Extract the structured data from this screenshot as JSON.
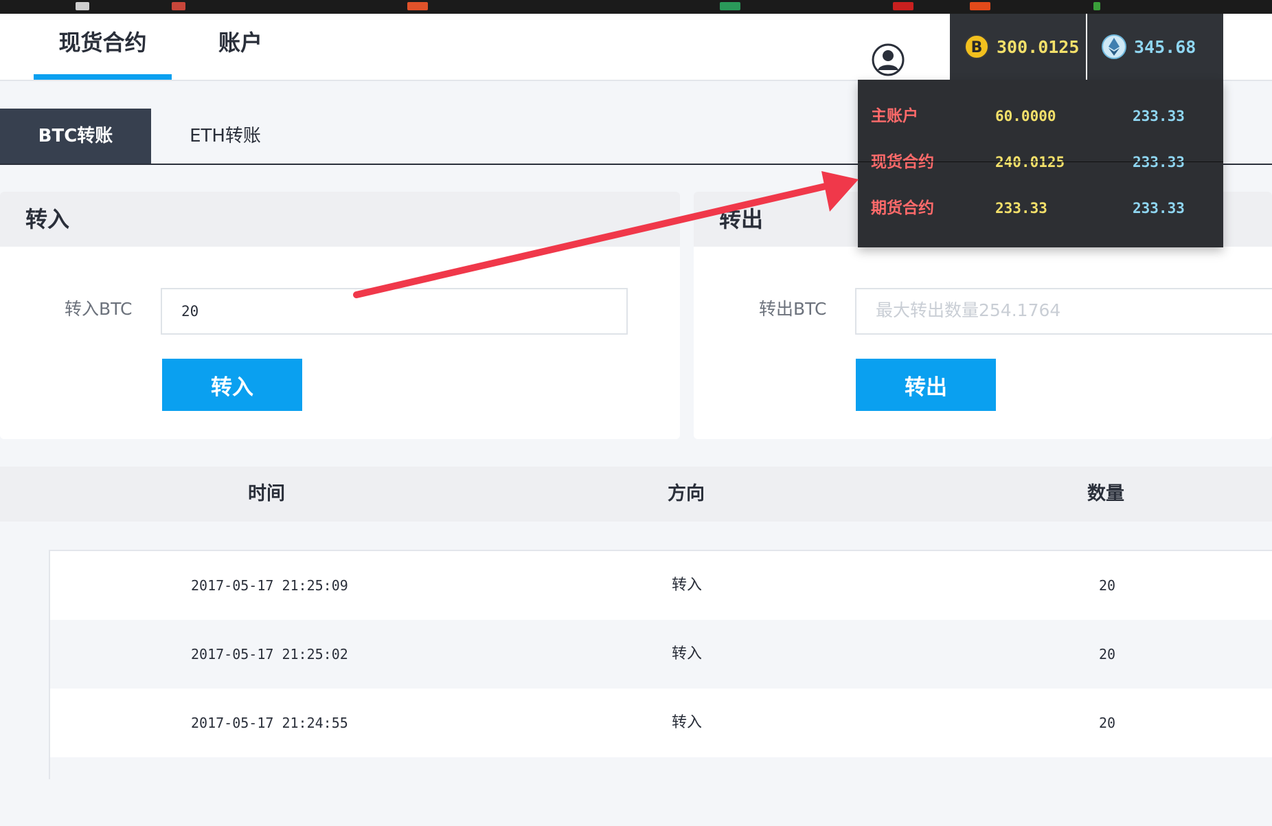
{
  "nav": {
    "tabs": [
      {
        "label": "现货合约"
      },
      {
        "label": "账户"
      }
    ],
    "active_tab": 0
  },
  "balances": {
    "btc": {
      "value": "300.0125",
      "icon": "bitcoin-icon",
      "color": "#f3e06a"
    },
    "eth": {
      "value": "345.68",
      "icon": "ethereum-icon",
      "color": "#8fd6f2"
    }
  },
  "balance_dropdown": {
    "rows": [
      {
        "name": "主账户",
        "btc": "60.0000",
        "eth": "233.33"
      },
      {
        "name": "现货合约",
        "btc": "240.0125",
        "eth": "233.33"
      },
      {
        "name": "期货合约",
        "btc": "233.33",
        "eth": "233.33"
      }
    ]
  },
  "subtabs": [
    {
      "label": "BTC转账"
    },
    {
      "label": "ETH转账"
    }
  ],
  "transfer_in": {
    "title": "转入",
    "label": "转入BTC",
    "value": "20",
    "button": "转入"
  },
  "transfer_out": {
    "title": "转出",
    "label": "转出BTC",
    "placeholder": "最大转出数量254.1764",
    "button": "转出"
  },
  "history": {
    "columns": [
      "时间",
      "方向",
      "数量"
    ],
    "rows": [
      {
        "time": "2017-05-17 21:25:09",
        "direction": "转入",
        "amount": "20"
      },
      {
        "time": "2017-05-17 21:25:02",
        "direction": "转入",
        "amount": "20"
      },
      {
        "time": "2017-05-17 21:24:55",
        "direction": "转入",
        "amount": "20"
      }
    ]
  },
  "colors": {
    "accent": "#0aa0f0",
    "dark_panel": "#2d2f33",
    "account_name": "#ff6a6a",
    "arrow": "#f0384a"
  }
}
